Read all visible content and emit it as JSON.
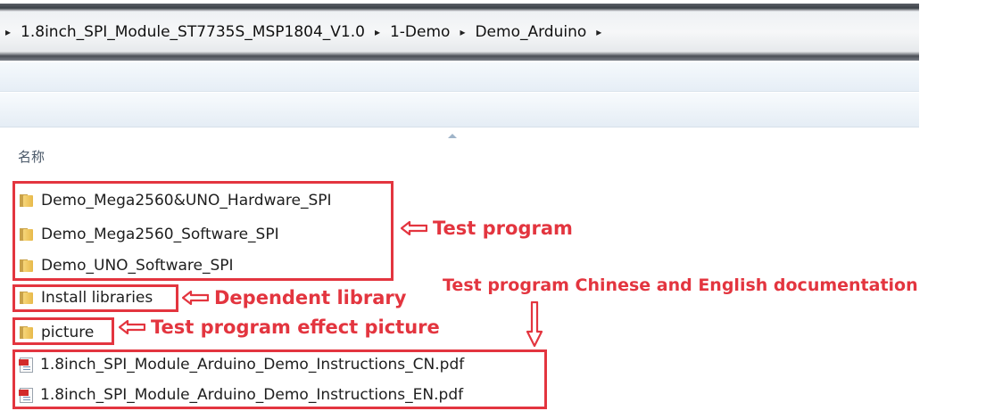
{
  "address_bar": {
    "breadcrumbs": [
      "1.8inch_SPI_Module_ST7735S_MSP1804_V1.0",
      "1-Demo",
      "Demo_Arduino"
    ],
    "separator": "▸"
  },
  "file_list": {
    "column_header": "名称",
    "items": [
      {
        "name": "Demo_Mega2560&UNO_Hardware_SPI",
        "type": "folder"
      },
      {
        "name": "Demo_Mega2560_Software_SPI",
        "type": "folder"
      },
      {
        "name": "Demo_UNO_Software_SPI",
        "type": "folder"
      },
      {
        "name": "Install libraries",
        "type": "folder"
      },
      {
        "name": "picture",
        "type": "folder"
      },
      {
        "name": "1.8inch_SPI_Module_Arduino_Demo_Instructions_CN.pdf",
        "type": "pdf"
      },
      {
        "name": "1.8inch_SPI_Module_Arduino_Demo_Instructions_EN.pdf",
        "type": "pdf"
      }
    ]
  },
  "annotations": {
    "test_program": "Test program",
    "dependent_library": "Dependent library",
    "effect_picture": "Test program effect picture",
    "documentation": "Test program Chinese and English documentation"
  },
  "colors": {
    "annotation": "#e3353f",
    "folder": "#f0c860",
    "header_text": "#4a5868"
  }
}
